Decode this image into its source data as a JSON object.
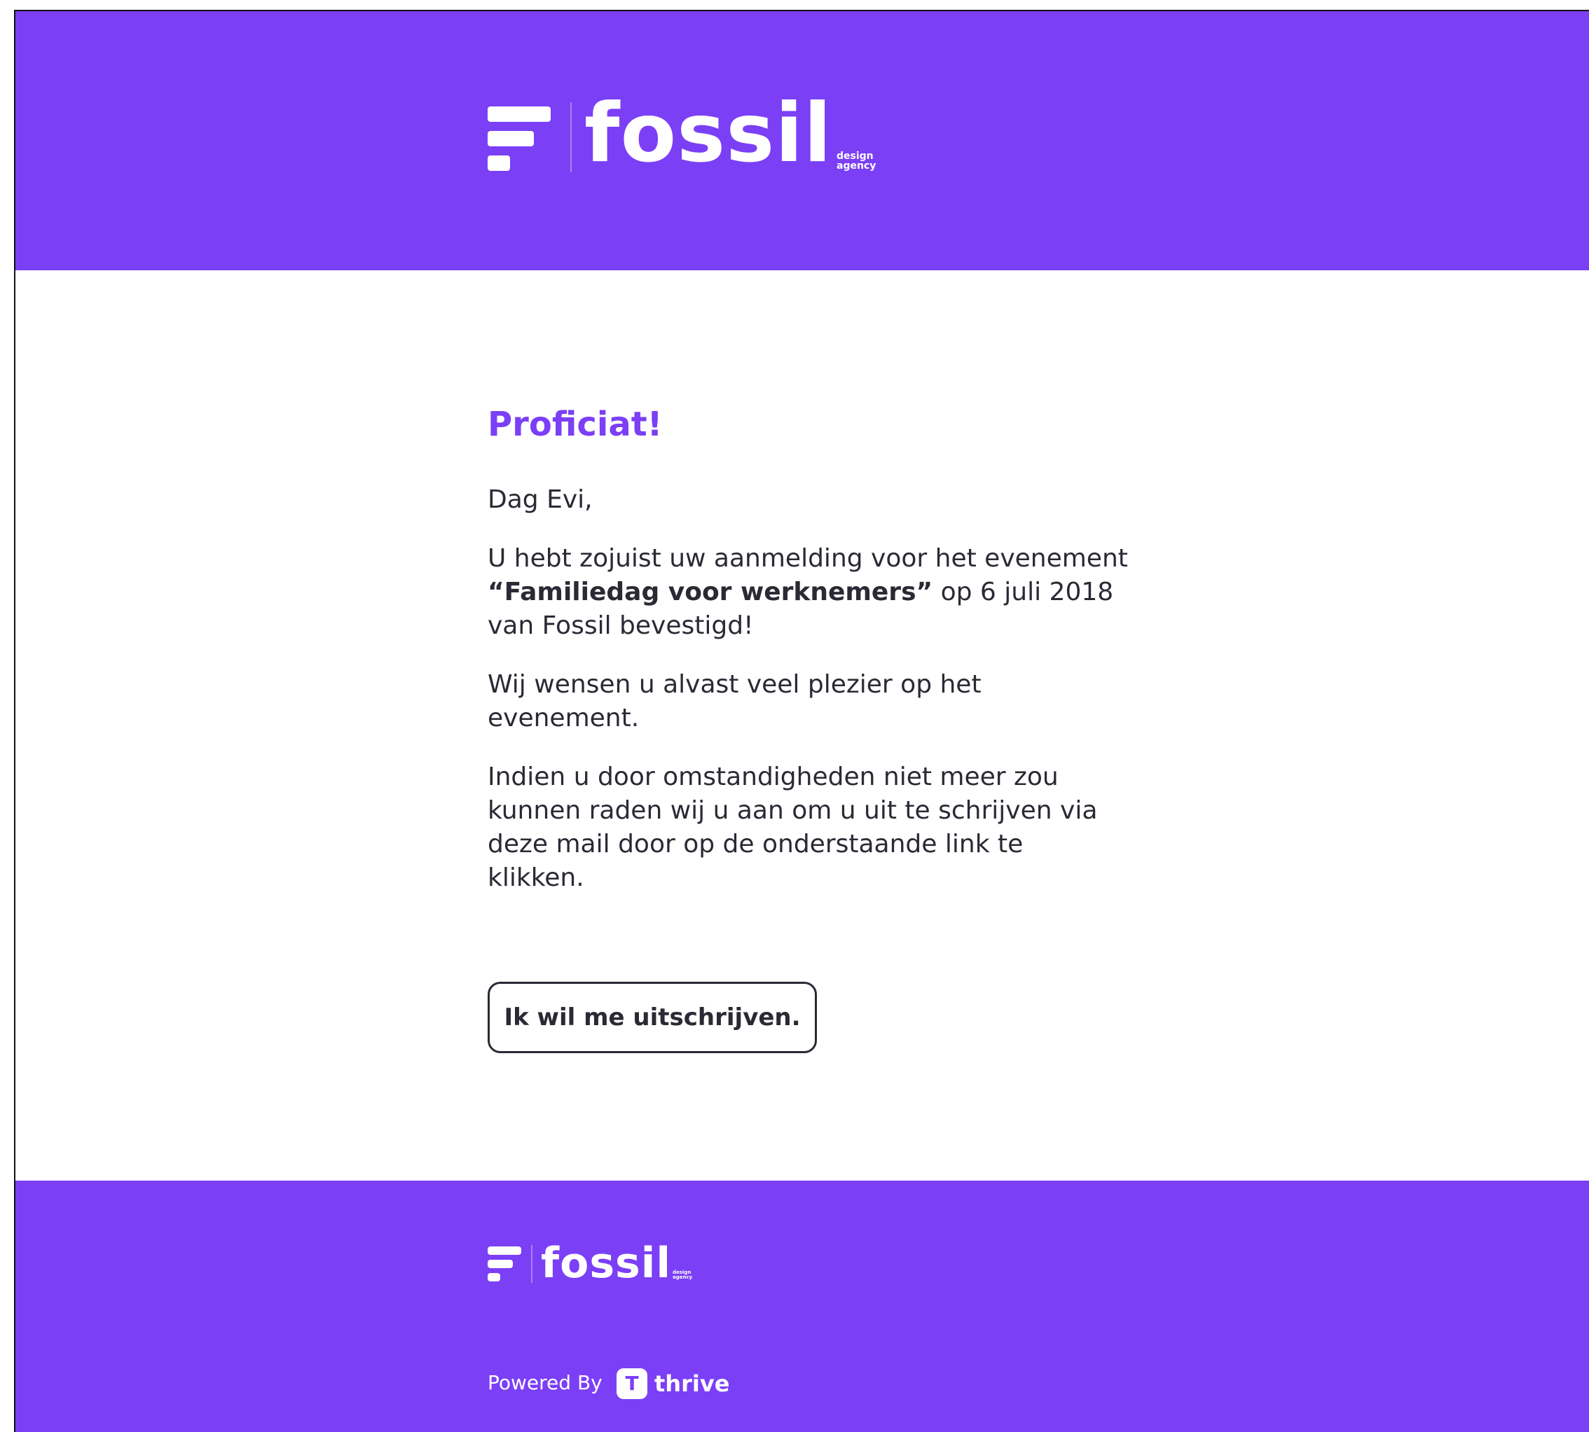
{
  "colors": {
    "brand": "#7b3ff6",
    "text": "#2a2a35",
    "background": "#ffffff"
  },
  "header": {
    "logo": {
      "word": "fossil",
      "sub_line1": "design",
      "sub_line2": "agency",
      "icon": "fossil-logo-icon"
    }
  },
  "main": {
    "headline": "Proficiat!",
    "greeting": "Dag Evi,",
    "confirmation": {
      "part1": "U hebt zojuist uw aanmelding voor het evenement ",
      "event_name": "“Familiedag voor werknemers”",
      "part2": " op 6 juli 2018 van Fossil bevestigd!"
    },
    "wish": "Wij wensen u alvast veel plezier op het evenement.",
    "instructions": "Indien u door omstandigheden niet meer zou kunnen raden wij u aan om u uit te schrijven via deze mail door op de onderstaande link te klikken.",
    "unsubscribe_button": "Ik wil me uitschrijven."
  },
  "footer": {
    "logo": {
      "word": "fossil",
      "sub_line1": "design",
      "sub_line2": "agency",
      "icon": "fossil-logo-icon"
    },
    "powered_by": "Powered By",
    "thrive_icon": "T",
    "thrive_name": "thrive"
  }
}
